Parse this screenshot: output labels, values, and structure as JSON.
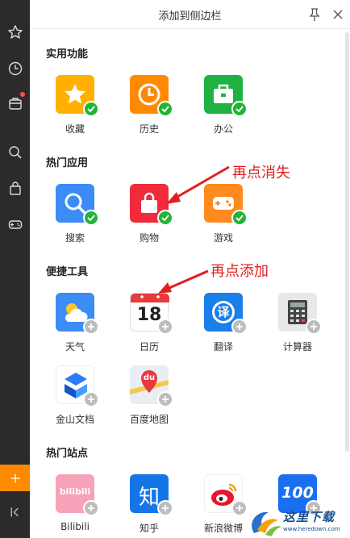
{
  "header": {
    "title": "添加到侧边栏"
  },
  "annotations": {
    "top": "再点消失",
    "bottom": "再点添加"
  },
  "watermark": {
    "text": "这里下载",
    "url": "www.heredown.com"
  },
  "sections": [
    {
      "title": "实用功能",
      "items": [
        {
          "label": "收藏",
          "icon": "star-icon",
          "color": "#ffb000",
          "state": "added"
        },
        {
          "label": "历史",
          "icon": "clock-icon",
          "color": "#ff8a00",
          "state": "added"
        },
        {
          "label": "办公",
          "icon": "briefcase-icon",
          "color": "#1fb141",
          "state": "added"
        }
      ]
    },
    {
      "title": "热门应用",
      "items": [
        {
          "label": "搜索",
          "icon": "search-icon",
          "color": "#3b8df5",
          "state": "added"
        },
        {
          "label": "购物",
          "icon": "shopping-bag-icon",
          "color": "#f12a3c",
          "state": "added"
        },
        {
          "label": "游戏",
          "icon": "gamepad-icon",
          "color": "#ff8a1e",
          "state": "added"
        }
      ]
    },
    {
      "title": "便捷工具",
      "items": [
        {
          "label": "天气",
          "icon": "weather-icon",
          "color": "#3b8df5",
          "state": "not-added"
        },
        {
          "label": "日历",
          "icon": "calendar-icon",
          "color": "#ffffff",
          "state": "not-added",
          "day": "18"
        },
        {
          "label": "翻译",
          "icon": "translate-icon",
          "color": "#1a7fe8",
          "state": "not-added",
          "glyph": "译"
        },
        {
          "label": "计算器",
          "icon": "calculator-icon",
          "color": "#e8e8e8",
          "state": "not-added"
        },
        {
          "label": "金山文档",
          "icon": "kingsoft-docs-icon",
          "color": "#ffffff",
          "state": "not-added"
        },
        {
          "label": "百度地图",
          "icon": "baidu-map-icon",
          "color": "#e8eef4",
          "state": "not-added",
          "glyph": "du"
        }
      ]
    },
    {
      "title": "热门站点",
      "items": [
        {
          "label": "Bilibili",
          "icon": "bilibili-icon",
          "color": "#f7a2b9",
          "state": "not-added",
          "glyph": "bilibili"
        },
        {
          "label": "知乎",
          "icon": "zhihu-icon",
          "color": "#1476e6",
          "state": "not-added",
          "glyph": "知"
        },
        {
          "label": "新浪微博",
          "icon": "weibo-icon",
          "color": "#ffffff",
          "state": "not-added"
        },
        {
          "label": "",
          "icon": "100-icon",
          "color": "#1a6ff0",
          "state": "not-added",
          "glyph": "100"
        }
      ]
    }
  ]
}
